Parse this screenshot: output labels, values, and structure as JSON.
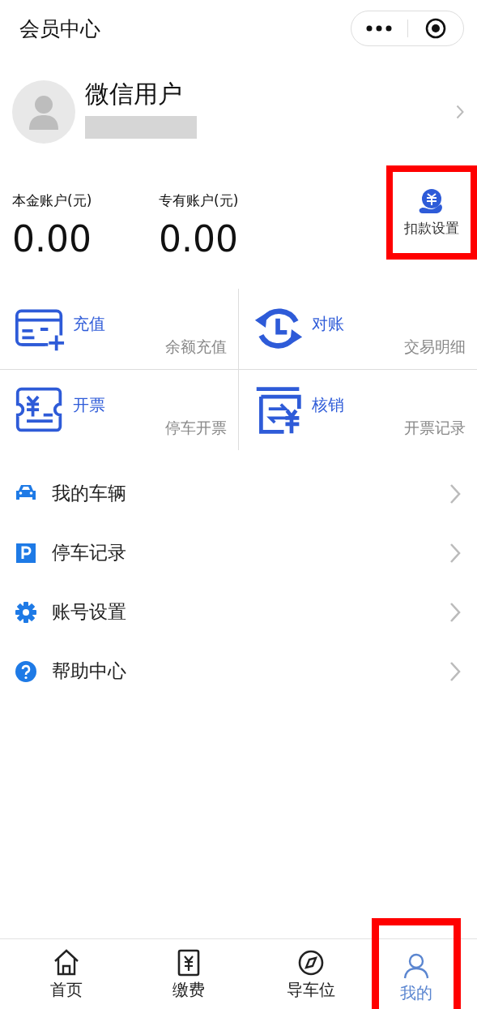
{
  "window": {
    "title": "会员中心"
  },
  "profile": {
    "name": "微信用户"
  },
  "balances": [
    {
      "label": "本金账户(元)",
      "amount": "0.00"
    },
    {
      "label": "专有账户(元)",
      "amount": "0.00"
    }
  ],
  "deduction_setting": {
    "label": "扣款设置",
    "highlighted": true
  },
  "services": [
    {
      "kind": "recharge",
      "title": "充值",
      "subtitle": "余额充值"
    },
    {
      "kind": "reconcile",
      "title": "对账",
      "subtitle": "交易明细"
    },
    {
      "kind": "invoice",
      "title": "开票",
      "subtitle": "停车开票"
    },
    {
      "kind": "writeoff",
      "title": "核销",
      "subtitle": "开票记录"
    }
  ],
  "menu": [
    {
      "kind": "car",
      "label": "我的车辆"
    },
    {
      "kind": "parking",
      "label": "停车记录"
    },
    {
      "kind": "gear",
      "label": "账号设置"
    },
    {
      "kind": "help",
      "label": "帮助中心"
    }
  ],
  "tabs": [
    {
      "kind": "home",
      "label": "首页",
      "selected": false,
      "highlighted": false
    },
    {
      "kind": "pay",
      "label": "缴费",
      "selected": false,
      "highlighted": false
    },
    {
      "kind": "compass",
      "label": "导车位",
      "selected": false,
      "highlighted": false
    },
    {
      "kind": "user",
      "label": "我的",
      "selected": true,
      "highlighted": true
    }
  ]
}
